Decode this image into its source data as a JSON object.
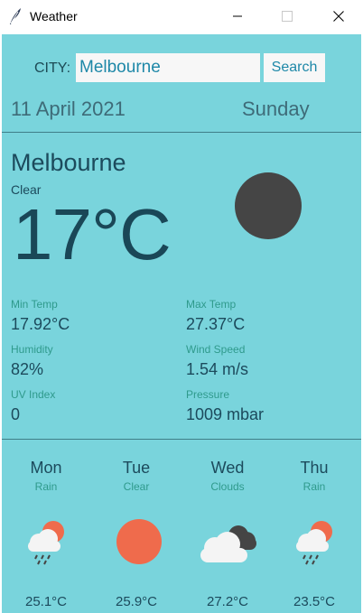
{
  "window": {
    "title": "Weather"
  },
  "search": {
    "city_label": "CITY:",
    "city_value": "Melbourne",
    "button_label": "Search"
  },
  "header": {
    "date": "11 April 2021",
    "day": "Sunday"
  },
  "current": {
    "city": "Melbourne",
    "condition": "Clear",
    "temperature": "17°C",
    "icon": "moon-icon"
  },
  "stats": [
    {
      "label": "Min Temp",
      "value": "17.92°C"
    },
    {
      "label": "Max Temp",
      "value": "27.37°C"
    },
    {
      "label": "Humidity",
      "value": "82%"
    },
    {
      "label": "Wind Speed",
      "value": "1.54 m/s"
    },
    {
      "label": "UV Index",
      "value": "0"
    },
    {
      "label": "Pressure",
      "value": "1009 mbar"
    }
  ],
  "forecast": [
    {
      "day": "Mon",
      "desc": "Rain",
      "temp": "25.1°C",
      "icon": "rain-icon"
    },
    {
      "day": "Tue",
      "desc": "Clear",
      "temp": "25.9°C",
      "icon": "sun-icon"
    },
    {
      "day": "Wed",
      "desc": "Clouds",
      "temp": "27.2°C",
      "icon": "clouds-icon"
    },
    {
      "day": "Thu",
      "desc": "Rain",
      "temp": "23.5°C",
      "icon": "rain-icon"
    }
  ],
  "colors": {
    "background": "#79d4dc",
    "sun": "#ef6b4c",
    "moon": "#454545",
    "cloud_light": "#f4f4f4",
    "cloud_dark": "#454545"
  }
}
